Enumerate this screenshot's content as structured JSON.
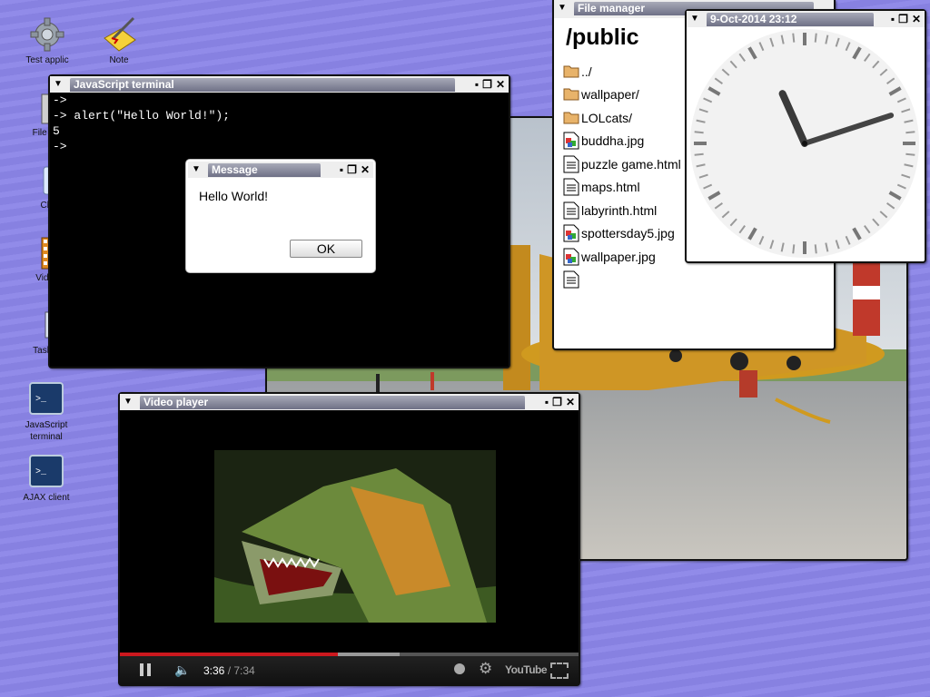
{
  "desktop": {
    "icons": [
      {
        "label": "Test applic",
        "icon": "gear-icon"
      },
      {
        "label": "Note",
        "icon": "note-icon"
      },
      {
        "label": "File ma",
        "icon": "folder-icon"
      },
      {
        "label": "Clo",
        "icon": "clock-icon"
      },
      {
        "label": "Video",
        "icon": "film-icon"
      },
      {
        "label": "Task m",
        "icon": "monitor-icon"
      },
      {
        "label": "JavaScript terminal",
        "icon": "terminal-icon"
      },
      {
        "label": "AJAX client",
        "icon": "terminal-icon"
      }
    ]
  },
  "terminal": {
    "title": "JavaScript terminal",
    "lines": [
      "->",
      "-> alert(\"Hello World!\");",
      "5",
      "->"
    ]
  },
  "message": {
    "title": "Message",
    "text": "Hello World!",
    "ok_label": "OK"
  },
  "file_manager": {
    "title": "File manager",
    "path": "/public",
    "items": [
      {
        "name": "../",
        "type": "folder"
      },
      {
        "name": "wallpaper/",
        "type": "folder"
      },
      {
        "name": "LOLcats/",
        "type": "folder"
      },
      {
        "name": "buddha.jpg",
        "type": "image"
      },
      {
        "name": "puzzle game.html",
        "type": "document"
      },
      {
        "name": "maps.html",
        "type": "document"
      },
      {
        "name": "labyrinth.html",
        "type": "document"
      },
      {
        "name": "spottersday5.jpg",
        "type": "image"
      },
      {
        "name": "wallpaper.jpg",
        "type": "image"
      },
      {
        "name": "",
        "type": "document"
      }
    ]
  },
  "clock": {
    "title": "9-Oct-2014 23:12",
    "hour": 23,
    "minute": 12
  },
  "video": {
    "title": "Video player",
    "current_time": "3:36",
    "separator": " / ",
    "duration": "7:34",
    "played_fraction": 0.475,
    "buffered_fraction": 0.61,
    "brand": "YouTube"
  },
  "colors": {
    "desktop": "#8b85e8",
    "title_active": "#6e7086",
    "progress": "#cc181e"
  }
}
